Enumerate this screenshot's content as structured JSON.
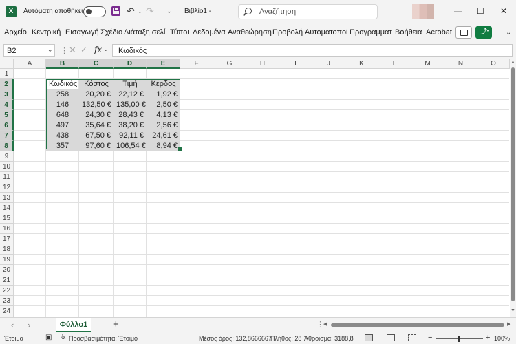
{
  "titlebar": {
    "app_icon": "excel-logo",
    "app_icon_letter": "X",
    "autosave_label": "Αυτόματη αποθήκευση",
    "autosave_on": false,
    "doc_title": "Βιβλίο1  -",
    "search_placeholder": "Αναζήτηση"
  },
  "menu": {
    "items": [
      "Αρχείο",
      "Κεντρική",
      "Εισαγωγή",
      "Σχέδιο",
      "Διάταξη σελί",
      "Τύποι",
      "Δεδομένα",
      "Αναθεώρηση",
      "Προβολή",
      "Αυτοματοποί",
      "Προγραμματι",
      "Βοήθεια",
      "Acrobat"
    ]
  },
  "formula_bar": {
    "name_box": "B2",
    "fx_label": "fx",
    "content": "Κωδικός"
  },
  "columns": [
    "A",
    "B",
    "C",
    "D",
    "E",
    "F",
    "G",
    "H",
    "I",
    "J",
    "K",
    "L",
    "M",
    "N",
    "O"
  ],
  "rows": [
    "1",
    "2",
    "3",
    "4",
    "5",
    "6",
    "7",
    "8",
    "9",
    "10",
    "11",
    "12",
    "13",
    "14",
    "15",
    "16",
    "17",
    "18",
    "19",
    "20",
    "21",
    "22",
    "23",
    "24",
    "25"
  ],
  "table": {
    "headers": [
      "Κωδικός",
      "Κόστος",
      "Τιμή",
      "Κέρδος"
    ],
    "rows": [
      [
        "258",
        "20,20 €",
        "22,12 €",
        "1,92 €"
      ],
      [
        "146",
        "132,50 €",
        "135,00 €",
        "2,50 €"
      ],
      [
        "648",
        "24,30 €",
        "28,43 €",
        "4,13 €"
      ],
      [
        "497",
        "35,64 €",
        "38,20 €",
        "2,56 €"
      ],
      [
        "438",
        "67,50 €",
        "92,11 €",
        "24,61 €"
      ],
      [
        "357",
        "97,60 €",
        "106,54 €",
        "8,94 €"
      ]
    ]
  },
  "sheet_tabs": {
    "active": "Φύλλο1",
    "add": "+"
  },
  "status": {
    "ready": "Έτοιμο",
    "accessibility": "Προσβασιμότητα: Έτοιμο",
    "average": "Μέσος όρος: 132,8666667",
    "count": "Πλήθος: 28",
    "sum": "Άθροισμα: 3188,8",
    "zoom": "100%"
  }
}
